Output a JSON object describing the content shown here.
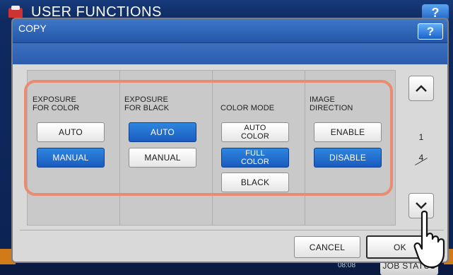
{
  "background": {
    "app_title": "USER FUNCTIONS",
    "help_label": "?",
    "time": "08:08",
    "job_status_label": "JOB STATUS"
  },
  "dialog": {
    "title": "COPY",
    "help_label": "?"
  },
  "columns": [
    {
      "label": "EXPOSURE\nFOR COLOR",
      "options": [
        {
          "label": "AUTO",
          "selected": false
        },
        {
          "label": "MANUAL",
          "selected": true
        }
      ]
    },
    {
      "label": "EXPOSURE\nFOR BLACK",
      "options": [
        {
          "label": "AUTO",
          "selected": true
        },
        {
          "label": "MANUAL",
          "selected": false
        }
      ]
    },
    {
      "label": "COLOR MODE",
      "options": [
        {
          "label": "AUTO\nCOLOR",
          "selected": false
        },
        {
          "label": "FULL\nCOLOR",
          "selected": true
        },
        {
          "label": "BLACK",
          "selected": false
        }
      ]
    },
    {
      "label": "IMAGE\nDIRECTION",
      "options": [
        {
          "label": "ENABLE",
          "selected": false
        },
        {
          "label": "DISABLE",
          "selected": true
        }
      ]
    }
  ],
  "pagination": {
    "current": "1",
    "total": "4",
    "up_icon": "chevron-up-icon",
    "down_icon": "chevron-down-icon"
  },
  "footer": {
    "cancel_label": "CANCEL",
    "ok_label": "OK"
  },
  "colors": {
    "selected": "#1f6bd0",
    "highlight": "#e98c72",
    "title_bar": "#2c5cae"
  }
}
